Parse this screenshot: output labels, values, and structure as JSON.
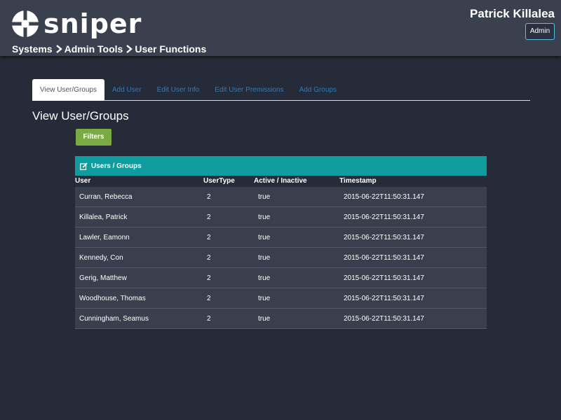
{
  "app": {
    "logo_text": "sniper",
    "user_name": "Patrick Killalea",
    "role_label": "Admin"
  },
  "breadcrumb": [
    "Systems",
    "Admin Tools",
    "User Functions"
  ],
  "tabs": [
    {
      "label": "View User/Groups",
      "active": true
    },
    {
      "label": "Add User",
      "active": false
    },
    {
      "label": "Edit User Info",
      "active": false
    },
    {
      "label": "Edit User Premissions",
      "active": false
    },
    {
      "label": "Add Groups",
      "active": false
    }
  ],
  "page_title": "View User/Groups",
  "filters_label": "Filters",
  "panel": {
    "title": "Users / Groups",
    "columns": [
      "User",
      "UserType",
      "Active / Inactive",
      "Timestamp"
    ],
    "rows": [
      {
        "user": "Curran, Rebecca",
        "type": "2",
        "active": "true",
        "timestamp": "2015-06-22T11:50:31.147"
      },
      {
        "user": "Killalea, Patrick",
        "type": "2",
        "active": "true",
        "timestamp": "2015-06-22T11:50:31.147"
      },
      {
        "user": "Lawler, Eamonn",
        "type": "2",
        "active": "true",
        "timestamp": "2015-06-22T11:50:31.147"
      },
      {
        "user": "Kennedy, Con",
        "type": "2",
        "active": "true",
        "timestamp": "2015-06-22T11:50:31.147"
      },
      {
        "user": "Gerig, Matthew",
        "type": "2",
        "active": "true",
        "timestamp": "2015-06-22T11:50:31.147"
      },
      {
        "user": "Woodhouse, Thomas",
        "type": "2",
        "active": "true",
        "timestamp": "2015-06-22T11:50:31.147"
      },
      {
        "user": "Cunningham, Seamus",
        "type": "2",
        "active": "true",
        "timestamp": "2015-06-22T11:50:31.147"
      }
    ]
  },
  "colors": {
    "background": "#252b38",
    "header": "#3a404e",
    "accent_teal": "#0e9c9e",
    "filters_green": "#7aab43",
    "link_blue": "#337ab7",
    "row": "#3a3f4e"
  },
  "icons": {
    "logo": "crosshair-logo-icon",
    "breadcrumb_separator": "chevron-right-icon",
    "panel_heading": "edit-icon"
  }
}
